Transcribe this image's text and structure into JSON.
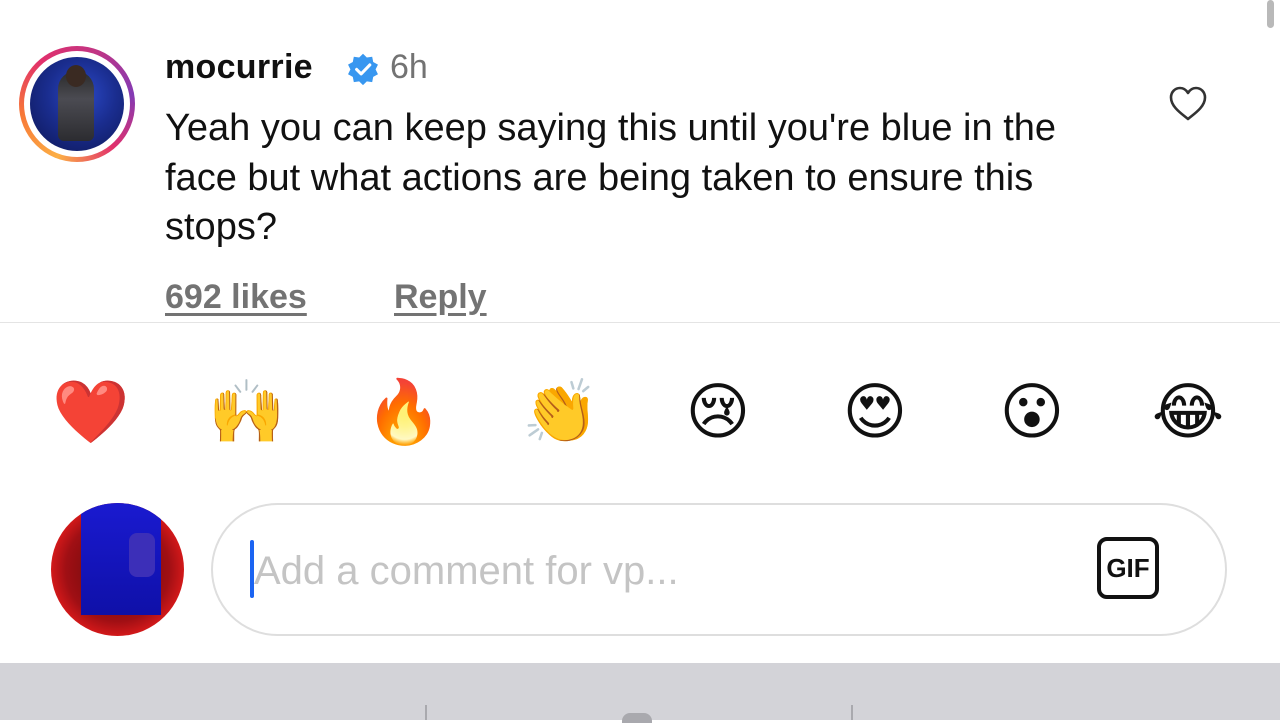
{
  "comment": {
    "username": "mocurrie",
    "verified": true,
    "time": "6h",
    "text": "Yeah you can keep saying this until you're blue in the face but what actions are being taken to ensure this stops?",
    "likes_label": "692 likes",
    "reply_label": "Reply",
    "like_icon": "heart-outline-icon"
  },
  "reactions": [
    {
      "name": "heart",
      "glyph": "❤️"
    },
    {
      "name": "raising-hands",
      "glyph": "🙌"
    },
    {
      "name": "fire",
      "glyph": "🔥"
    },
    {
      "name": "clapping-hands",
      "glyph": "👏"
    },
    {
      "name": "crying-face",
      "glyph": "😢"
    },
    {
      "name": "heart-eyes",
      "glyph": "😍"
    },
    {
      "name": "surprised-face",
      "glyph": "😮"
    },
    {
      "name": "tears-of-joy",
      "glyph": "😂"
    }
  ],
  "composer": {
    "placeholder": "Add a comment for vp...",
    "value": "",
    "gif_label": "GIF"
  },
  "colors": {
    "verified_badge": "#3897f0",
    "caret": "#1b64f2",
    "secondary_text": "#737373"
  }
}
